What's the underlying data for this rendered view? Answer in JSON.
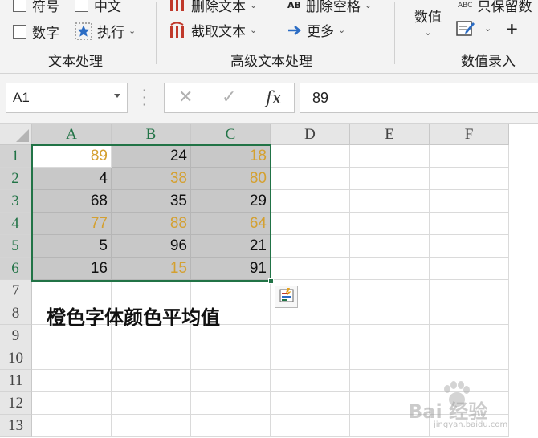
{
  "ribbon": {
    "text_group": {
      "symbol_label": "符号",
      "chinese_label": "中文",
      "digit_label": "数字",
      "execute_label": "执行",
      "group_label": "文本处理"
    },
    "advanced_group": {
      "delete_text_label": "删除文本",
      "extract_text_label": "截取文本",
      "delete_spaces_label": "删除空格",
      "more_label": "更多",
      "group_label": "高级文本处理"
    },
    "number_group": {
      "number_label": "数值",
      "keep_number_label": "只保留数",
      "group_label": "数值录入",
      "plus_label": "+"
    }
  },
  "formula_bar": {
    "name_box": "A1",
    "fx_label": "fx",
    "cancel_glyph": "✕",
    "enter_glyph": "✓",
    "formula_value": "89"
  },
  "sheet": {
    "columns": [
      "A",
      "B",
      "C",
      "D",
      "E",
      "F"
    ],
    "rows": [
      "1",
      "2",
      "3",
      "4",
      "5",
      "6",
      "7",
      "8",
      "9",
      "10",
      "11",
      "12",
      "13"
    ],
    "cells": [
      [
        {
          "v": "89",
          "c": "orange"
        },
        {
          "v": "24",
          "c": "black"
        },
        {
          "v": "18",
          "c": "orange"
        }
      ],
      [
        {
          "v": "4",
          "c": "black"
        },
        {
          "v": "38",
          "c": "orange"
        },
        {
          "v": "80",
          "c": "orange"
        }
      ],
      [
        {
          "v": "68",
          "c": "black"
        },
        {
          "v": "35",
          "c": "black"
        },
        {
          "v": "29",
          "c": "black"
        }
      ],
      [
        {
          "v": "77",
          "c": "orange"
        },
        {
          "v": "88",
          "c": "orange"
        },
        {
          "v": "64",
          "c": "orange"
        }
      ],
      [
        {
          "v": "5",
          "c": "black"
        },
        {
          "v": "96",
          "c": "black"
        },
        {
          "v": "21",
          "c": "black"
        }
      ],
      [
        {
          "v": "16",
          "c": "black"
        },
        {
          "v": "15",
          "c": "orange"
        },
        {
          "v": "91",
          "c": "black"
        }
      ]
    ],
    "note_a8": "橙色字体颜色平均值",
    "active_cell": "A1",
    "selection": "A1:C6"
  },
  "watermark": {
    "main": "Bai 经验",
    "sub": "jingyan.baidu.com"
  },
  "colors": {
    "accent_green": "#217346",
    "orange_font": "#d4a030",
    "selection_fill": "#c8c8c8"
  }
}
